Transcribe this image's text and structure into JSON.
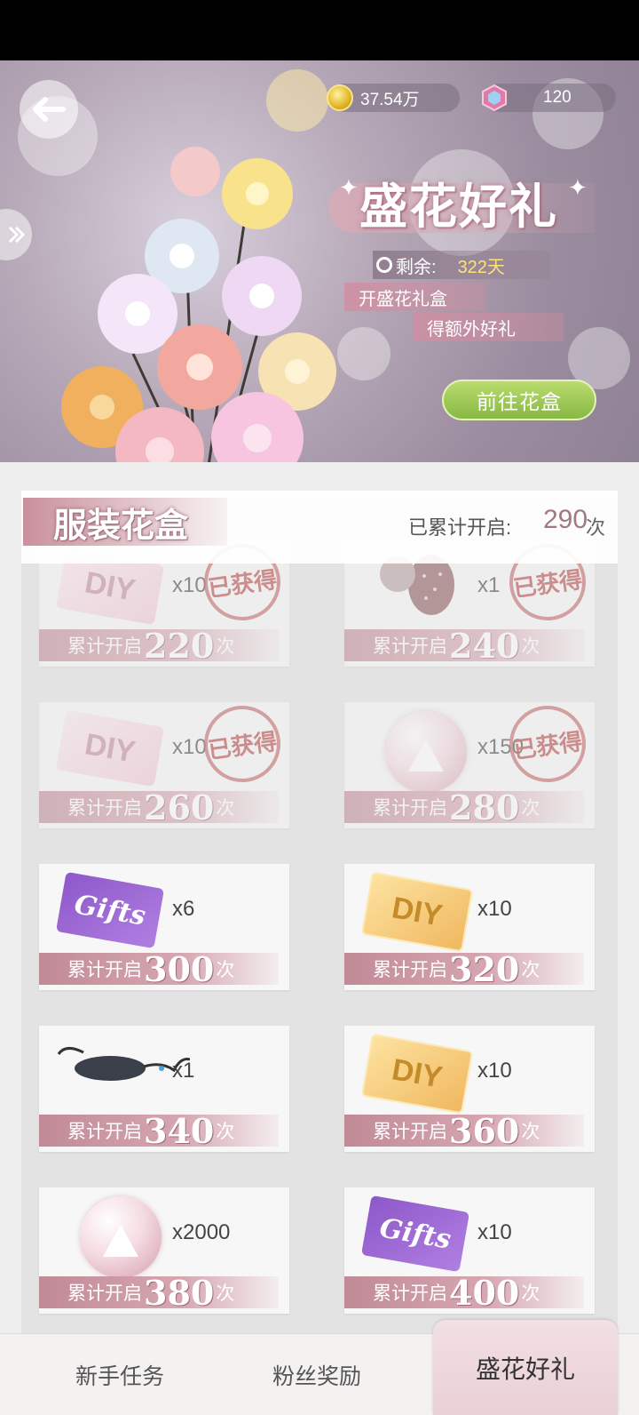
{
  "header": {
    "coins": "37.54万",
    "gems": "120"
  },
  "banner": {
    "title": "盛花好礼",
    "remain_label": "剩余:",
    "remain_value": "322天",
    "tag_open": "开盛花礼盒",
    "tag_extra": "得额外好礼",
    "go_button": "前往花盒"
  },
  "section": {
    "title": "服装花盒",
    "opened_label": "已累计开启:",
    "opened_count": "290",
    "opened_unit": "次"
  },
  "rewards": [
    {
      "item": "diy-pink-ticket",
      "qty": "x10",
      "pre": "累计开启",
      "count": "220",
      "unit": "次",
      "obtained": true,
      "stamp": "已获得"
    },
    {
      "item": "strawberry",
      "qty": "x1",
      "pre": "累计开启",
      "count": "240",
      "unit": "次",
      "obtained": true,
      "stamp": "已获得"
    },
    {
      "item": "diy-pink-ticket",
      "qty": "x10",
      "pre": "累计开启",
      "count": "260",
      "unit": "次",
      "obtained": true,
      "stamp": "已获得"
    },
    {
      "item": "dress-orb",
      "qty": "x150",
      "pre": "累计开启",
      "count": "280",
      "unit": "次",
      "obtained": true,
      "stamp": "已获得"
    },
    {
      "item": "gift-ticket",
      "qty": "x6",
      "pre": "累计开启",
      "count": "300",
      "unit": "次",
      "obtained": false
    },
    {
      "item": "diy-gold-ticket",
      "qty": "x10",
      "pre": "累计开启",
      "count": "320",
      "unit": "次",
      "obtained": false
    },
    {
      "item": "sunglasses",
      "qty": "x1",
      "pre": "累计开启",
      "count": "340",
      "unit": "次",
      "obtained": false
    },
    {
      "item": "diy-gold-ticket",
      "qty": "x10",
      "pre": "累计开启",
      "count": "360",
      "unit": "次",
      "obtained": false
    },
    {
      "item": "dress-orb",
      "qty": "x2000",
      "pre": "累计开启",
      "count": "380",
      "unit": "次",
      "obtained": false
    },
    {
      "item": "gift-ticket",
      "qty": "x10",
      "pre": "累计开启",
      "count": "400",
      "unit": "次",
      "obtained": false
    }
  ],
  "ticket_text": {
    "diy": "DIY",
    "gift": "Gifts"
  },
  "bottom_nav": {
    "tab1": "新手任务",
    "tab2": "粉丝奖励",
    "tab3": "盛花好礼"
  }
}
